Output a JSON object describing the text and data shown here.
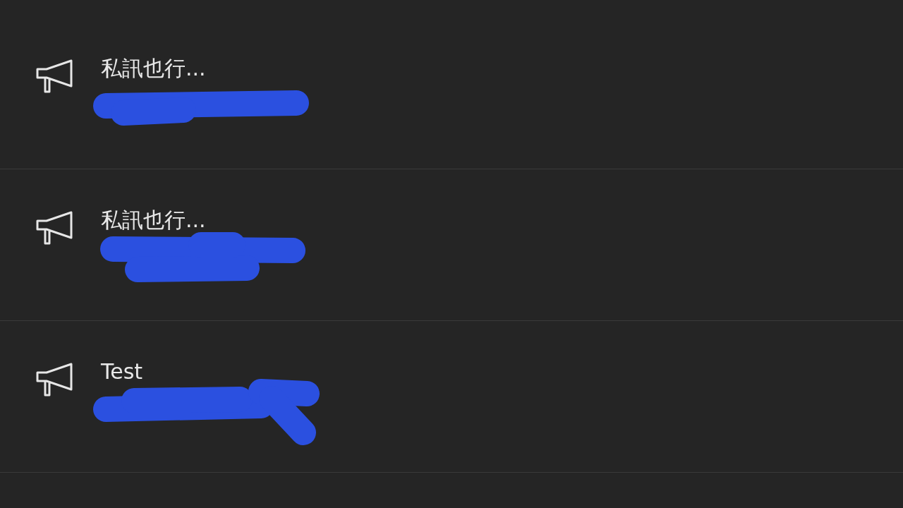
{
  "notifications": [
    {
      "title": "私訊也行..."
    },
    {
      "title": "私訊也行..."
    },
    {
      "title": "Test"
    }
  ]
}
